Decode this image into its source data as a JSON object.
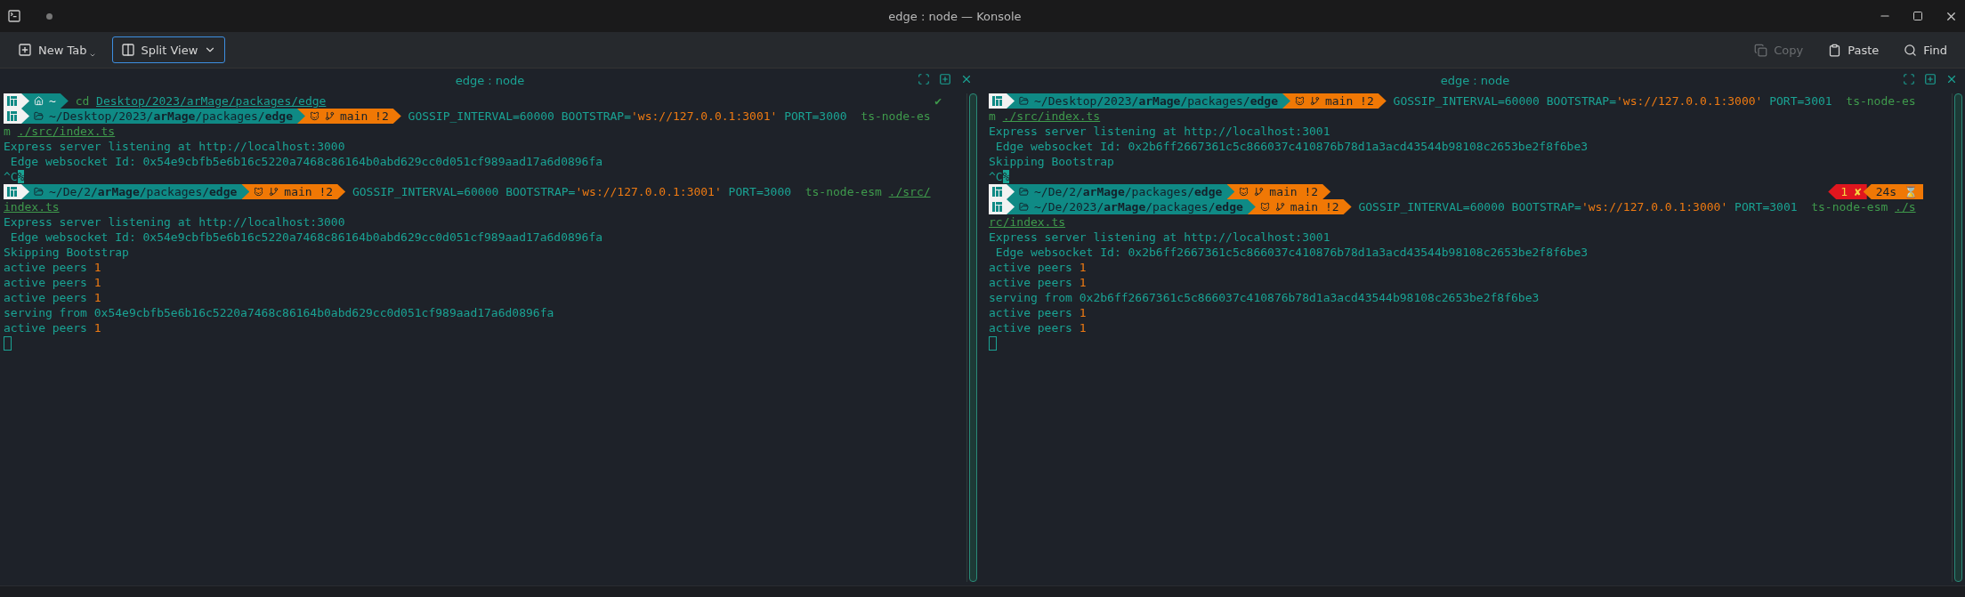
{
  "window": {
    "title": "edge : node — Konsole"
  },
  "toolbar": {
    "left": [
      {
        "kind": "new-tab",
        "label": "New Tab",
        "focused": false
      },
      {
        "kind": "split",
        "label": "Split View",
        "focused": true
      }
    ],
    "right": [
      {
        "kind": "copy",
        "label": "Copy",
        "disabled": true
      },
      {
        "kind": "paste",
        "label": "Paste",
        "disabled": false
      },
      {
        "kind": "find",
        "label": "Find",
        "disabled": false
      }
    ]
  },
  "panes": [
    {
      "title": "edge : node",
      "lines": [
        {
          "kind": "prompt",
          "segments": [
            {
              "kind": "os"
            },
            {
              "kind": "home",
              "text": "~"
            }
          ],
          "command": [
            {
              "kind": "cmd",
              "text": "cd"
            },
            {
              "kind": "path-link",
              "text": "Desktop/2023/arMage/packages/edge",
              "spaced": true
            }
          ],
          "status": "✔"
        },
        {
          "kind": "prompt",
          "segments": [
            {
              "kind": "os"
            },
            {
              "kind": "dir",
              "text": "~/Desktop/2023/**arMage**/packages/**edge**"
            },
            {
              "kind": "git",
              "text": "main !2"
            }
          ],
          "command": [
            {
              "kind": "plain",
              "text": "GOSSIP_INTERVAL=60000 BOOTSTRAP="
            },
            {
              "kind": "string",
              "text": "'ws://127.0.0.1:3001'"
            },
            {
              "kind": "plain",
              "text": " PORT=3000  "
            },
            {
              "kind": "cmd",
              "text": "ts-node-es"
            }
          ]
        },
        {
          "kind": "text",
          "spans": [
            {
              "kind": "cmd",
              "text": "m"
            },
            {
              "kind": "file-link",
              "text": "./src/index.ts",
              "spaced": true
            }
          ]
        },
        {
          "kind": "text",
          "spans": [
            {
              "kind": "plain",
              "text": "Express server listening at http://localhost:3000"
            }
          ]
        },
        {
          "kind": "text",
          "spans": [
            {
              "kind": "plain",
              "text": " Edge websocket Id: 0x54e9cbfb5e6b16c5220a7468c86164b0abd629cc0d051cf989aad17a6d0896fa"
            }
          ]
        },
        {
          "kind": "text",
          "spans": [
            {
              "kind": "plain",
              "text": "^C"
            },
            {
              "kind": "inverse",
              "text": "%"
            }
          ]
        },
        {
          "kind": "prompt",
          "segments": [
            {
              "kind": "os"
            },
            {
              "kind": "dir",
              "text": "~/De/2/**arMage**/packages/**edge**"
            },
            {
              "kind": "git",
              "text": "main !2"
            }
          ],
          "command": [
            {
              "kind": "plain",
              "text": "GOSSIP_INTERVAL=60000 BOOTSTRAP="
            },
            {
              "kind": "string",
              "text": "'ws://127.0.0.1:3001'"
            },
            {
              "kind": "plain",
              "text": " PORT=3000  "
            },
            {
              "kind": "cmd",
              "text": "ts-node-esm"
            },
            {
              "kind": "file-link",
              "text": "./src/",
              "spaced": true
            }
          ]
        },
        {
          "kind": "text",
          "spans": [
            {
              "kind": "file-link",
              "text": "index.ts"
            }
          ]
        },
        {
          "kind": "text",
          "spans": [
            {
              "kind": "plain",
              "text": "Express server listening at http://localhost:3000"
            }
          ]
        },
        {
          "kind": "text",
          "spans": [
            {
              "kind": "plain",
              "text": " Edge websocket Id: 0x54e9cbfb5e6b16c5220a7468c86164b0abd629cc0d051cf989aad17a6d0896fa"
            }
          ]
        },
        {
          "kind": "text",
          "spans": [
            {
              "kind": "plain",
              "text": "Skipping Bootstrap"
            }
          ]
        },
        {
          "kind": "text",
          "spans": [
            {
              "kind": "plain",
              "text": "active peers "
            },
            {
              "kind": "number",
              "text": "1"
            }
          ]
        },
        {
          "kind": "text",
          "spans": [
            {
              "kind": "plain",
              "text": "active peers "
            },
            {
              "kind": "number",
              "text": "1"
            }
          ]
        },
        {
          "kind": "text",
          "spans": [
            {
              "kind": "plain",
              "text": "active peers "
            },
            {
              "kind": "number",
              "text": "1"
            }
          ]
        },
        {
          "kind": "text",
          "spans": [
            {
              "kind": "plain",
              "text": "serving from 0x54e9cbfb5e6b16c5220a7468c86164b0abd629cc0d051cf989aad17a6d0896fa"
            }
          ]
        },
        {
          "kind": "text",
          "spans": [
            {
              "kind": "plain",
              "text": "active peers "
            },
            {
              "kind": "number",
              "text": "1"
            }
          ]
        },
        {
          "kind": "cursor"
        }
      ]
    },
    {
      "title": "edge : node",
      "lines": [
        {
          "kind": "prompt",
          "segments": [
            {
              "kind": "os"
            },
            {
              "kind": "dir",
              "text": "~/Desktop/2023/**arMage**/packages/**edge**"
            },
            {
              "kind": "git",
              "text": "main !2"
            }
          ],
          "command": [
            {
              "kind": "plain",
              "text": "GOSSIP_INTERVAL=60000 BOOTSTRAP="
            },
            {
              "kind": "string",
              "text": "'ws://127.0.0.1:3000'"
            },
            {
              "kind": "plain",
              "text": " PORT=3001  "
            },
            {
              "kind": "cmd",
              "text": "ts-node-es"
            }
          ]
        },
        {
          "kind": "text",
          "spans": [
            {
              "kind": "cmd",
              "text": "m"
            },
            {
              "kind": "file-link",
              "text": "./src/index.ts",
              "spaced": true
            }
          ]
        },
        {
          "kind": "text",
          "spans": [
            {
              "kind": "plain",
              "text": "Express server listening at http://localhost:3001"
            }
          ]
        },
        {
          "kind": "text",
          "spans": [
            {
              "kind": "plain",
              "text": " Edge websocket Id: 0x2b6ff2667361c5c866037c410876b78d1a3acd43544b98108c2653be2f8f6be3"
            }
          ]
        },
        {
          "kind": "text",
          "spans": [
            {
              "kind": "plain",
              "text": "Skipping Bootstrap"
            }
          ]
        },
        {
          "kind": "text",
          "spans": [
            {
              "kind": "plain",
              "text": "^C"
            },
            {
              "kind": "inverse",
              "text": "%"
            }
          ]
        },
        {
          "kind": "prompt",
          "segments": [
            {
              "kind": "os"
            },
            {
              "kind": "dir",
              "text": "~/De/2/**arMage**/packages/**edge**"
            },
            {
              "kind": "git",
              "text": "main !2"
            }
          ],
          "right": [
            {
              "kind": "error",
              "text": "1 ✘"
            },
            {
              "kind": "duration",
              "text": "24s ⌛"
            }
          ]
        },
        {
          "kind": "prompt",
          "segments": [
            {
              "kind": "os"
            },
            {
              "kind": "dir",
              "text": "~/De/2023/**arMage**/packages/**edge**"
            },
            {
              "kind": "git",
              "text": "main !2"
            }
          ],
          "command": [
            {
              "kind": "plain",
              "text": "GOSSIP_INTERVAL=60000 BOOTSTRAP="
            },
            {
              "kind": "string",
              "text": "'ws://127.0.0.1:3000'"
            },
            {
              "kind": "plain",
              "text": " PORT=3001  "
            },
            {
              "kind": "cmd",
              "text": "ts-node-esm"
            },
            {
              "kind": "file-link",
              "text": "./s",
              "spaced": true
            }
          ]
        },
        {
          "kind": "text",
          "spans": [
            {
              "kind": "file-link",
              "text": "rc/index.ts"
            }
          ]
        },
        {
          "kind": "text",
          "spans": [
            {
              "kind": "plain",
              "text": "Express server listening at http://localhost:3001"
            }
          ]
        },
        {
          "kind": "text",
          "spans": [
            {
              "kind": "plain",
              "text": " Edge websocket Id: 0x2b6ff2667361c5c866037c410876b78d1a3acd43544b98108c2653be2f8f6be3"
            }
          ]
        },
        {
          "kind": "text",
          "spans": [
            {
              "kind": "plain",
              "text": "active peers "
            },
            {
              "kind": "number",
              "text": "1"
            }
          ]
        },
        {
          "kind": "text",
          "spans": [
            {
              "kind": "plain",
              "text": "active peers "
            },
            {
              "kind": "number",
              "text": "1"
            }
          ]
        },
        {
          "kind": "text",
          "spans": [
            {
              "kind": "plain",
              "text": "serving from 0x2b6ff2667361c5c866037c410876b78d1a3acd43544b98108c2653be2f8f6be3"
            }
          ]
        },
        {
          "kind": "text",
          "spans": [
            {
              "kind": "plain",
              "text": "active peers "
            },
            {
              "kind": "number",
              "text": "1"
            }
          ]
        },
        {
          "kind": "text",
          "spans": [
            {
              "kind": "plain",
              "text": "active peers "
            },
            {
              "kind": "number",
              "text": "1"
            }
          ]
        },
        {
          "kind": "cursor"
        }
      ]
    }
  ]
}
